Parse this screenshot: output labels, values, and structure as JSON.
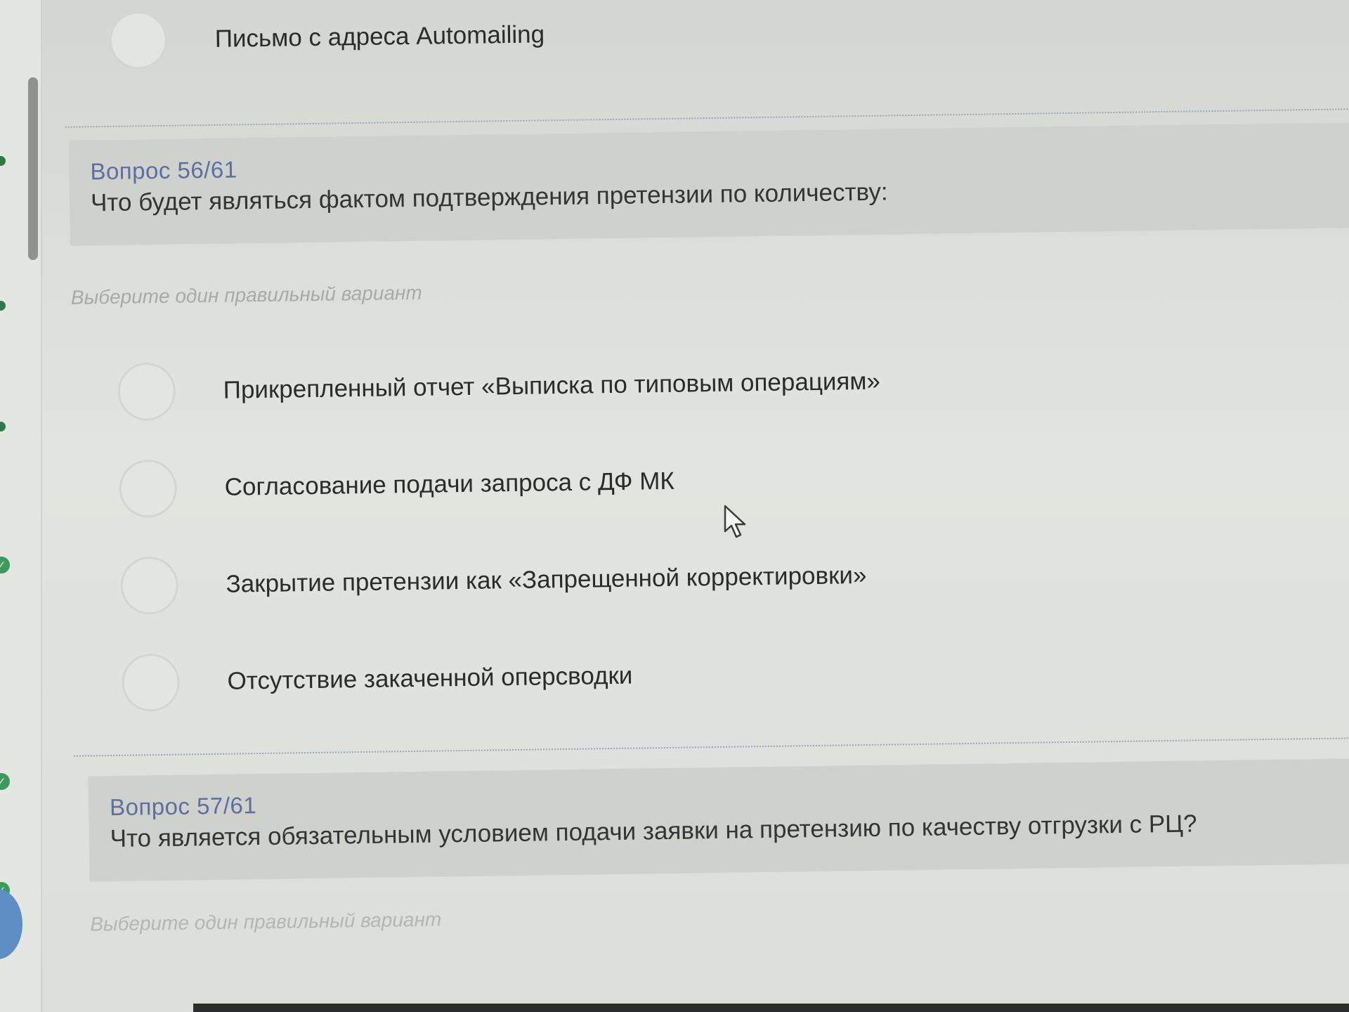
{
  "previous_question": {
    "option_label": "Письмо с адреса Automailing"
  },
  "question_56": {
    "number": "Вопрос 56/61",
    "text": "Что будет являться фактом подтверждения претензии по количеству:",
    "hint": "Выберите один правильный вариант",
    "options": [
      {
        "label": "Прикрепленный отчет «Выписка по типовым операциям»"
      },
      {
        "label": "Согласование подачи запроса с ДФ МК"
      },
      {
        "label": "Закрытие претензии как «Запрещенной корректировки»"
      },
      {
        "label": "Отсутствие закаченной оперсводки"
      }
    ]
  },
  "question_57": {
    "number": "Вопрос 57/61",
    "text": "Что является обязательным условием подачи заявки на претензию по качеству отгрузки с РЦ?",
    "hint": "Выберите один правильный вариант"
  },
  "icons": {
    "rail_status": "check-circle-icon",
    "cursor": "mouse-pointer-icon"
  },
  "colors": {
    "question_number": "#5c6f9f",
    "complete_status": "#3d9a5a",
    "question_background": "#cfd1cd"
  }
}
